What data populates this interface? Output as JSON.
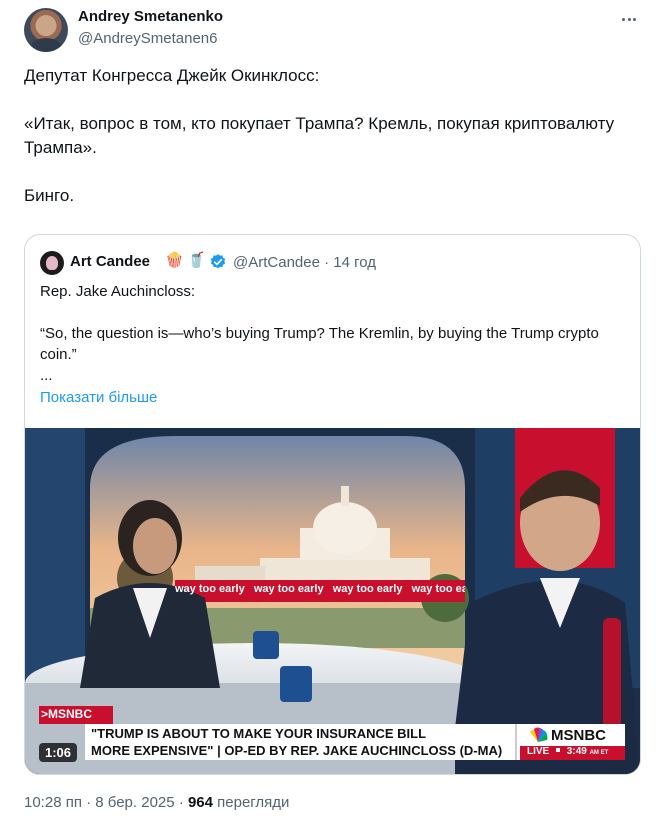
{
  "author": {
    "name": "Andrey Smetanenko",
    "handle": "@AndreySmetanen6"
  },
  "tweet": {
    "text": "Депутат Конгресса Джейк Окинклосс:\n\n«Итак, вопрос в том, кто покупает Трампа? Кремль, покупая криптовалюту Трампа».\n\nБинго."
  },
  "quote": {
    "name": "Art Candee",
    "emoji_1": "🍿",
    "emoji_2": "🥤",
    "handle_time": "@ArtCandee · 14 год",
    "text": "Rep. Jake Auchincloss:\n\n“So, the question is—who’s buying Trump? The Kremlin, by buying the Trump crypto coin.”\n...",
    "show_more": "Показати більше"
  },
  "video": {
    "duration": "1:06",
    "ticker_text": "way too early",
    "network_tag": ">MSNBC",
    "headline_line1": "\"TRUMP IS ABOUT TO MAKE YOUR INSURANCE BILL",
    "headline_line2": "MORE EXPENSIVE\" | OP-ED BY REP. JAKE AUCHINCLOSS (D-MA)",
    "logo": "MSNBC",
    "live": "LIVE",
    "clock": "3:49",
    "clock_suffix": "AM ET"
  },
  "footer": {
    "time": "10:28 пп · 8 бер. 2025 · ",
    "views_count": "964",
    "views_label": " перегляди"
  }
}
